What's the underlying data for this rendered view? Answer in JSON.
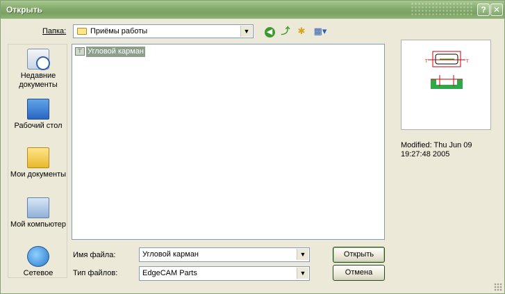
{
  "window": {
    "title": "Открыть",
    "help_label": "?",
    "close_label": "✕"
  },
  "toolbar": {
    "folder_label": "Папка:",
    "folder_value": "Приёмы работы",
    "icons": [
      "back-icon",
      "up-folder-icon",
      "new-folder-icon",
      "views-menu-icon"
    ]
  },
  "places": [
    {
      "label": "Недавние документы",
      "icon": "recent-documents-icon"
    },
    {
      "label": "Рабочий стол",
      "icon": "desktop-icon"
    },
    {
      "label": "Мои документы",
      "icon": "my-documents-icon"
    },
    {
      "label": "Мой компьютер",
      "icon": "my-computer-icon"
    },
    {
      "label": "Сетевое",
      "icon": "network-icon"
    }
  ],
  "files": [
    {
      "name": "Угловой карман",
      "selected": true
    }
  ],
  "preview": {
    "modified_line1": "Modified: Thu Jun 09",
    "modified_line2": "19:27:48 2005"
  },
  "form": {
    "filename_label": "Имя файла:",
    "filename_value": "Угловой карман",
    "filetype_label": "Тип файлов:",
    "filetype_value": "EdgeCAM Parts"
  },
  "buttons": {
    "open": "Открыть",
    "cancel": "Отмена"
  },
  "colors": {
    "titlebar": "#86ad6e",
    "selection": "#8c9f8a",
    "accent_green": "#3c9a2d"
  }
}
